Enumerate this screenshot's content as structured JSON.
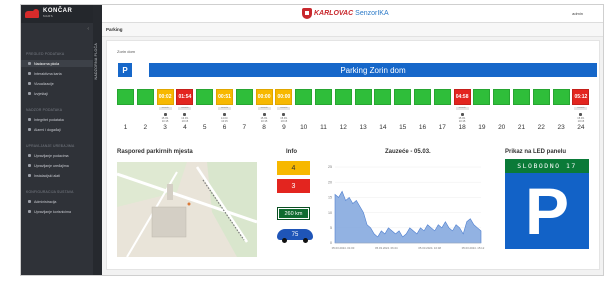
{
  "app": {
    "brand_left_name": "KONČAR",
    "brand_left_sub": "MARS",
    "brand_center_1": "KARLOVAC",
    "brand_center_2": "SenzorIKA",
    "user": "admin",
    "section_title": "Parking",
    "vertical_label": "NADZORNA PLOČA"
  },
  "sidebar": {
    "collapse_glyph": "‹",
    "sections": [
      {
        "title": "PREGLED PODATAKA",
        "items": [
          "Nadzorna ploča",
          "Interaktivna karta",
          "Vizualizacije",
          "Izvještaji"
        ]
      },
      {
        "title": "NADZOR PODATAKA",
        "items": [
          "Integritet podataka",
          "Alarmi i događaji"
        ]
      },
      {
        "title": "UPRAVLJANJE UREĐAJIMA",
        "items": [
          "Upravljanje podacima",
          "Upravljanje uređajima",
          "Instalacijski alati"
        ]
      },
      {
        "title": "KONFIGURACIJA SUSTAVA",
        "items": [
          "Administracija",
          "Upravljanje korisnicima"
        ]
      }
    ],
    "active_item": "Nadzorna ploča"
  },
  "parking": {
    "lot_label": "Zorin dom",
    "badge": "P",
    "lot_title": "Parking Zorin dom",
    "spaces": [
      {
        "n": "1",
        "state": "free",
        "time": ""
      },
      {
        "n": "2",
        "state": "free",
        "time": ""
      },
      {
        "n": "3",
        "state": "warn",
        "time": "00:02",
        "tag": "zauzeto",
        "date": "15.03. 10:15"
      },
      {
        "n": "4",
        "state": "occ",
        "time": "01:54",
        "tag": "zauzeto",
        "date": "13.03. 10:15"
      },
      {
        "n": "5",
        "state": "free",
        "time": ""
      },
      {
        "n": "6",
        "state": "warn",
        "time": "00:51",
        "tag": "zauzeto",
        "date": "14.03. 10:15"
      },
      {
        "n": "7",
        "state": "free",
        "time": ""
      },
      {
        "n": "8",
        "state": "warn",
        "time": "00:00",
        "tag": "zauzeto",
        "date": "15.03. 10:15"
      },
      {
        "n": "9",
        "state": "warn",
        "time": "00:00",
        "tag": "zauzeto",
        "date": "15.03. 10:15"
      },
      {
        "n": "10",
        "state": "free",
        "time": ""
      },
      {
        "n": "11",
        "state": "free",
        "time": ""
      },
      {
        "n": "12",
        "state": "free",
        "time": ""
      },
      {
        "n": "13",
        "state": "free",
        "time": ""
      },
      {
        "n": "14",
        "state": "free",
        "time": ""
      },
      {
        "n": "15",
        "state": "free",
        "time": ""
      },
      {
        "n": "16",
        "state": "free",
        "time": ""
      },
      {
        "n": "17",
        "state": "free",
        "time": ""
      },
      {
        "n": "18",
        "state": "occ",
        "time": "04:58",
        "tag": "zauzeto",
        "date": "15.03. 10:15"
      },
      {
        "n": "19",
        "state": "free",
        "time": ""
      },
      {
        "n": "20",
        "state": "free",
        "time": ""
      },
      {
        "n": "21",
        "state": "free",
        "time": ""
      },
      {
        "n": "22",
        "state": "free",
        "time": ""
      },
      {
        "n": "23",
        "state": "free",
        "time": ""
      },
      {
        "n": "24",
        "state": "occ",
        "time": "05:12",
        "tag": "zauzeto",
        "date": "15.03. 10:15"
      }
    ]
  },
  "panels": {
    "map_title": "Raspored parkirnih mjesta",
    "info_title": "Info",
    "chart_title": "Zauzeće - 05.03.",
    "led_title": "Prikaz na LED panelu"
  },
  "info": {
    "yellow_value": "4",
    "red_value": "3",
    "distance": "260 km",
    "car_value": "75"
  },
  "led": {
    "text": "SLOBODNO 17",
    "symbol": "P"
  },
  "chart_data": {
    "type": "area",
    "title": "Zauzeće - 05.03.",
    "xlabel": "",
    "ylabel": "",
    "ylim": [
      0,
      25
    ],
    "yticks": [
      "25",
      "20",
      "15",
      "10",
      "5",
      "0"
    ],
    "xticks": [
      "05.03.2024. 01:00",
      "05.03.2024. 06:24",
      "05.03.2024. 10:48",
      "05.03.2024. 15:12"
    ],
    "series": [
      {
        "values": [
          16,
          15,
          17,
          14,
          15,
          13,
          14,
          12,
          10,
          6,
          5,
          3,
          2,
          4,
          3,
          5,
          4,
          3,
          4,
          2,
          3,
          5,
          4,
          3,
          5,
          4,
          6,
          5,
          4,
          6,
          5,
          7,
          5,
          4,
          6,
          5,
          3,
          7,
          8,
          6,
          5,
          4
        ]
      }
    ],
    "color": "#7fa5dd"
  }
}
